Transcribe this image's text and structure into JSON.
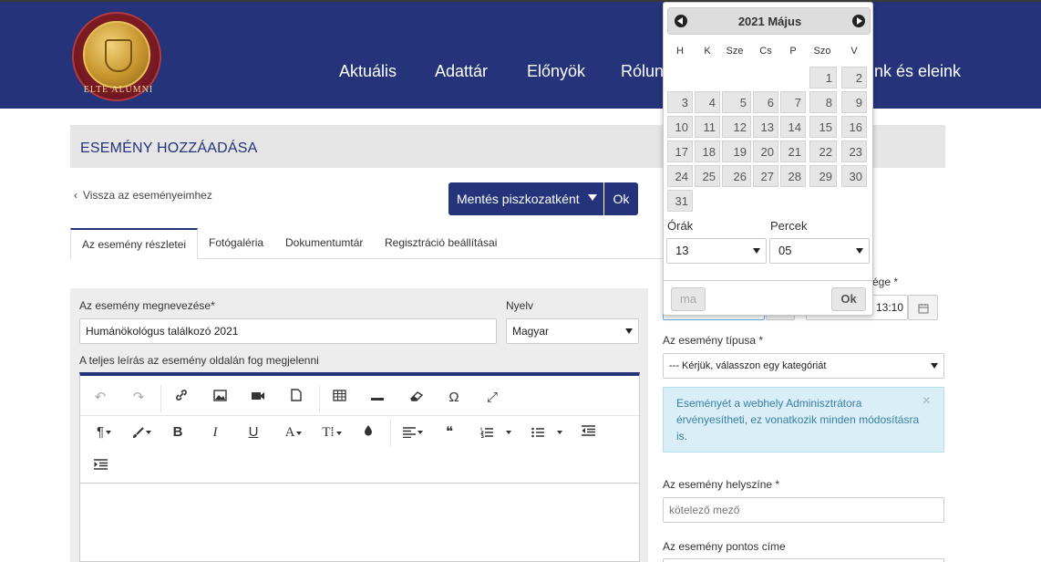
{
  "header": {
    "logo_text": "ELTE ALUMNI",
    "nav": [
      {
        "label": "Aktuális"
      },
      {
        "label": "Adattár"
      },
      {
        "label": "Előnyök"
      },
      {
        "label": "Rólun"
      },
      {
        "label": "ink és eleink"
      }
    ]
  },
  "page": {
    "title": "ESEMÉNY HOZZÁADÁSA",
    "back_label": "Vissza az eseményeimhez",
    "save_label": "Mentés piszkozatként",
    "ok_label": "Ok"
  },
  "tabs": [
    {
      "label": "Az esemény részletei",
      "active": true
    },
    {
      "label": "Fotógaléria",
      "active": false
    },
    {
      "label": "Dokumentumtár",
      "active": false
    },
    {
      "label": "Regisztráció beállításai",
      "active": false
    }
  ],
  "form": {
    "name_label": "Az esemény megnevezése*",
    "name_value": "Humánökológus találkozó 2021",
    "language_label": "Nyelv",
    "language_value": "Magyar",
    "description_label": "A teljes leírás az esemény oldalán fog megjelenni"
  },
  "right": {
    "end_label_partial": "ége *",
    "end_time_partial": "13:10",
    "type_label": "Az esemény típusa *",
    "type_value": "--- Kérjük, válasszon egy kategóriát",
    "info_text": "Eseményét a webhely Adminisztrátora érvényesítheti, ez vonatkozik minden módosításra is.",
    "info_close": "×",
    "location_label": "Az esemény helyszíne *",
    "location_placeholder": "kötelező mező",
    "address_label": "Az esemény pontos címe"
  },
  "datepicker": {
    "title": "2021 Május",
    "weekdays": [
      "H",
      "K",
      "Sze",
      "Cs",
      "P",
      "Szo",
      "V"
    ],
    "days": [
      "1",
      "2",
      "3",
      "4",
      "5",
      "6",
      "7",
      "8",
      "9",
      "10",
      "11",
      "12",
      "13",
      "14",
      "15",
      "16",
      "17",
      "18",
      "19",
      "20",
      "21",
      "22",
      "23",
      "24",
      "25",
      "26",
      "27",
      "28",
      "29",
      "30",
      "31"
    ],
    "hours_label": "Órák",
    "hours_value": "13",
    "minutes_label": "Percek",
    "minutes_value": "05",
    "today_label": "ma",
    "ok_label": "Ok"
  },
  "editor_toolbar": {
    "font_size_glyph": "T⁞",
    "font_color_glyph": "A",
    "paragraph_glyph": "¶",
    "bold_glyph": "B",
    "italic_glyph": "I",
    "underline_glyph": "U",
    "omega_glyph": "Ω",
    "quote_glyph": "❝"
  },
  "colors": {
    "brand": "#25337a",
    "info_bg": "#d9eef7",
    "info_text": "#3a7fa3"
  }
}
